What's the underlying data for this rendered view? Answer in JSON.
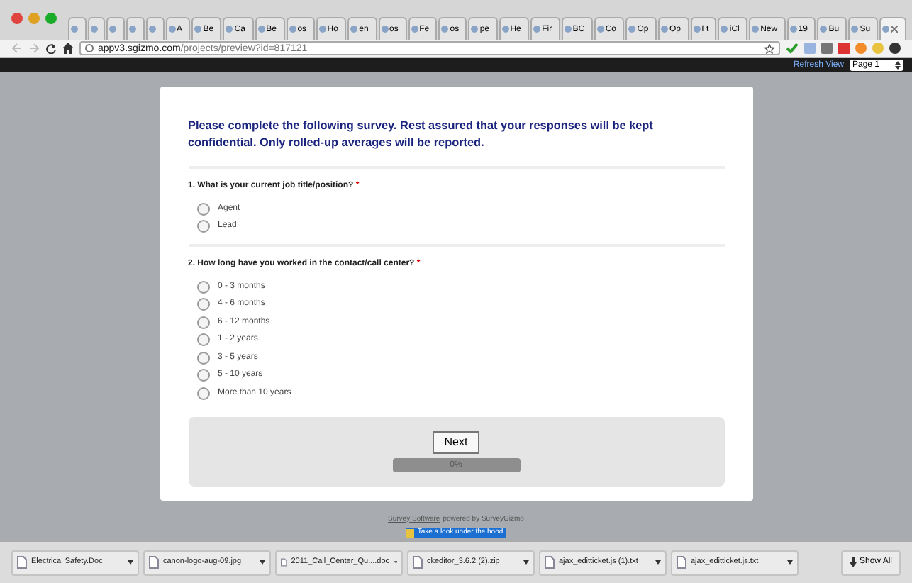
{
  "tabs": [
    {
      "selected": false
    },
    {
      "selected": false
    },
    {
      "selected": false
    },
    {
      "selected": false
    },
    {
      "selected": false
    },
    {
      "label": "A",
      "selected": false
    },
    {
      "label": "Be",
      "selected": false
    },
    {
      "label": "Ca",
      "selected": false
    },
    {
      "label": "Be",
      "selected": false
    },
    {
      "label": "os",
      "selected": false
    },
    {
      "label": "Ho",
      "selected": false
    },
    {
      "label": "en",
      "selected": false
    },
    {
      "label": "os",
      "selected": false
    },
    {
      "label": "Fe",
      "selected": false
    },
    {
      "label": "os",
      "selected": false
    },
    {
      "label": "pe",
      "selected": false
    },
    {
      "label": "He",
      "selected": false
    },
    {
      "label": "Fir",
      "selected": false
    },
    {
      "label": "BC",
      "selected": false
    },
    {
      "label": "Co",
      "selected": false
    },
    {
      "label": "Op",
      "selected": false
    },
    {
      "label": "Op",
      "selected": false
    },
    {
      "label": "I t",
      "selected": false
    },
    {
      "label": "iCl",
      "selected": false
    },
    {
      "label": "New",
      "selected": false
    },
    {
      "label": "19",
      "selected": false
    },
    {
      "label": "Bu",
      "selected": false
    },
    {
      "label": "Su",
      "selected": false
    },
    {
      "selected": true
    }
  ],
  "address": {
    "host": "appv3.sgizmo.com",
    "path": "/projects/preview?id=817121"
  },
  "preview_bar": {
    "refresh": "Refresh View",
    "page_select": "Page 1"
  },
  "survey": {
    "intro": "Please complete the following survey. Rest assured that your responses will be kept confidential. Only rolled-up averages will be reported.",
    "questions": [
      {
        "title": "1. What is your current job title/position?",
        "required_mark": "*",
        "options": [
          {
            "label": "Agent",
            "selected": false
          },
          {
            "label": "Lead",
            "selected": false
          }
        ]
      },
      {
        "title": "2. How long have you worked in the contact/call center?",
        "required_mark": "*",
        "options": [
          {
            "label": "0 - 3 months",
            "selected": false
          },
          {
            "label": "4 - 6 months",
            "selected": false
          },
          {
            "label": "6 - 12 months",
            "selected": false
          },
          {
            "label": "1 - 2 years",
            "selected": false
          },
          {
            "label": "3 - 5 years",
            "selected": false
          },
          {
            "label": "5 - 10 years",
            "selected": false
          },
          {
            "label": "More than 10 years",
            "selected": false
          }
        ]
      }
    ],
    "next": "Next",
    "progress": {
      "level": 0,
      "reading": "0%"
    }
  },
  "footer": {
    "link": "Survey Software",
    "text": "powered by SurveyGizmo",
    "badge": "Take a look under the hood"
  },
  "downloads": [
    {
      "name": "Electrical Safety.Doc"
    },
    {
      "name": "canon-logo-aug-09.jpg"
    },
    {
      "name": "2011_Call_Center_Qu....doc"
    },
    {
      "name": "ckeditor_3.6.2 (2).zip"
    },
    {
      "name": "ajax_editticket.js (1).txt"
    },
    {
      "name": "ajax_editticket.js.txt"
    }
  ],
  "show_all": "Show All"
}
